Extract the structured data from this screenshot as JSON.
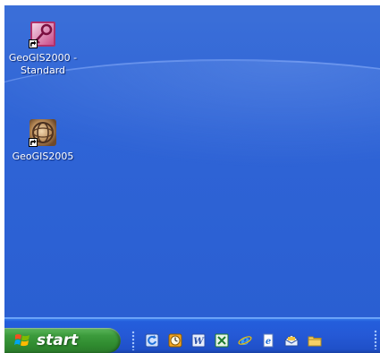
{
  "desktop": {
    "icons": [
      {
        "label": "GeoGIS2000 -\nStandard",
        "icon": "access-key-icon"
      },
      {
        "label": "GeoGIS2005",
        "icon": "geogis-globe-icon"
      }
    ]
  },
  "taskbar": {
    "start_label": "start",
    "quick_launch": [
      "ie-refresh-icon",
      "clock-icon",
      "word-icon",
      "excel-icon",
      "internet-explorer-icon",
      "ie-page-icon",
      "outlook-icon",
      "folder-icon"
    ]
  },
  "colors": {
    "desktop_blue": "#2f64d6",
    "taskbar_blue": "#245edc",
    "start_green": "#3c9b3c"
  }
}
